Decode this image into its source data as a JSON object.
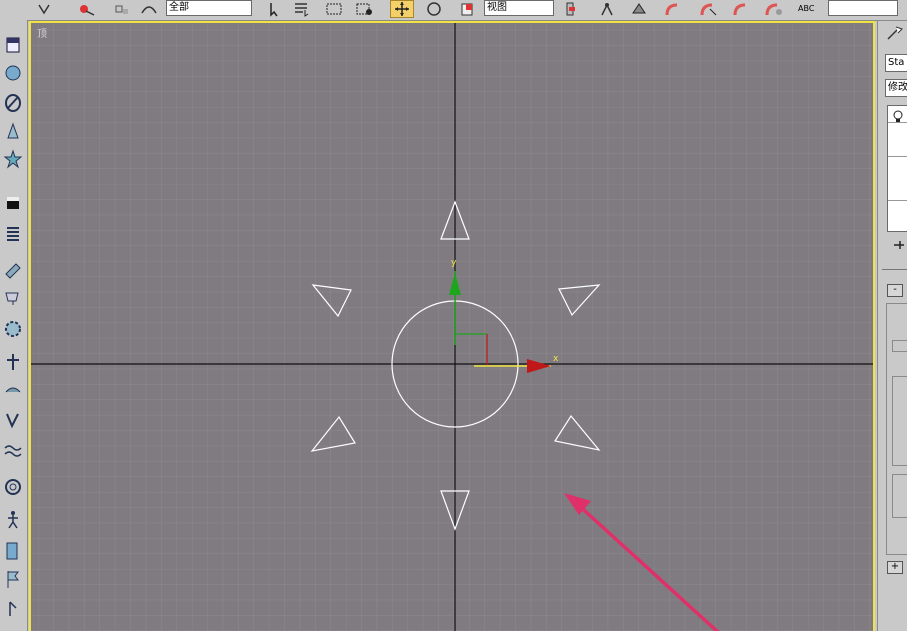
{
  "toolbar": {
    "selection_filter_value": "全部",
    "reference_coord_value": "视图",
    "named_selection_label": "ABC"
  },
  "viewport": {
    "label": "顶",
    "axis_x_label": "x",
    "axis_y_label": "y",
    "border_color": "#f0e442",
    "background_color": "#7f7b80",
    "arrow_color": "#e0306a"
  },
  "command_panel": {
    "object_name": "Sta",
    "modifier_list": "修改",
    "minus_button": "-",
    "plus_button": "+"
  }
}
